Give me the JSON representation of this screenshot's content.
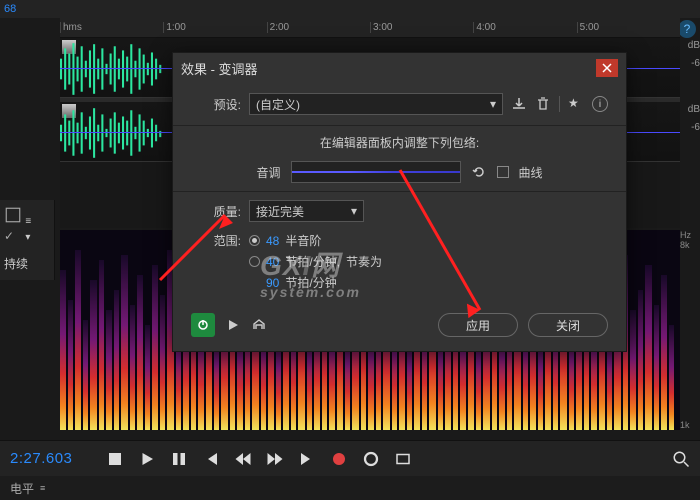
{
  "topbar": {
    "samplerate_fragment": "68"
  },
  "ruler": {
    "hms": "hms",
    "ticks": [
      "1:00",
      "2:00",
      "3:00",
      "4:00",
      "5:00"
    ]
  },
  "db": {
    "label": "dB",
    "neg6": "-6"
  },
  "hz": {
    "label": "Hz",
    "v8k": "8k",
    "v1k": "1k"
  },
  "left_panel": {
    "sustain": "持续"
  },
  "transport": {
    "timecode": "2:27.603"
  },
  "bottom": {
    "level": "电平"
  },
  "dialog": {
    "title": "效果 - 变调器",
    "preset_label": "预设:",
    "preset_value": "(自定义)",
    "envelope_msg": "在编辑器面板内调整下列包络:",
    "pitch_label": "音调",
    "curve_label": "曲线",
    "quality_label": "质量:",
    "quality_value": "接近完美",
    "range_label": "范围:",
    "semitone": {
      "value": "48",
      "unit": "半音阶"
    },
    "bpm1": {
      "value": "40",
      "unit": "节拍/分钟,",
      "extra": "节奏为"
    },
    "bpm2": {
      "value": "90",
      "unit": "节拍/分钟"
    },
    "apply": "应用",
    "close": "关闭"
  },
  "watermark": {
    "line1": "GX",
    "dot": "I",
    "suffix": "网",
    "line2": "system.com"
  }
}
